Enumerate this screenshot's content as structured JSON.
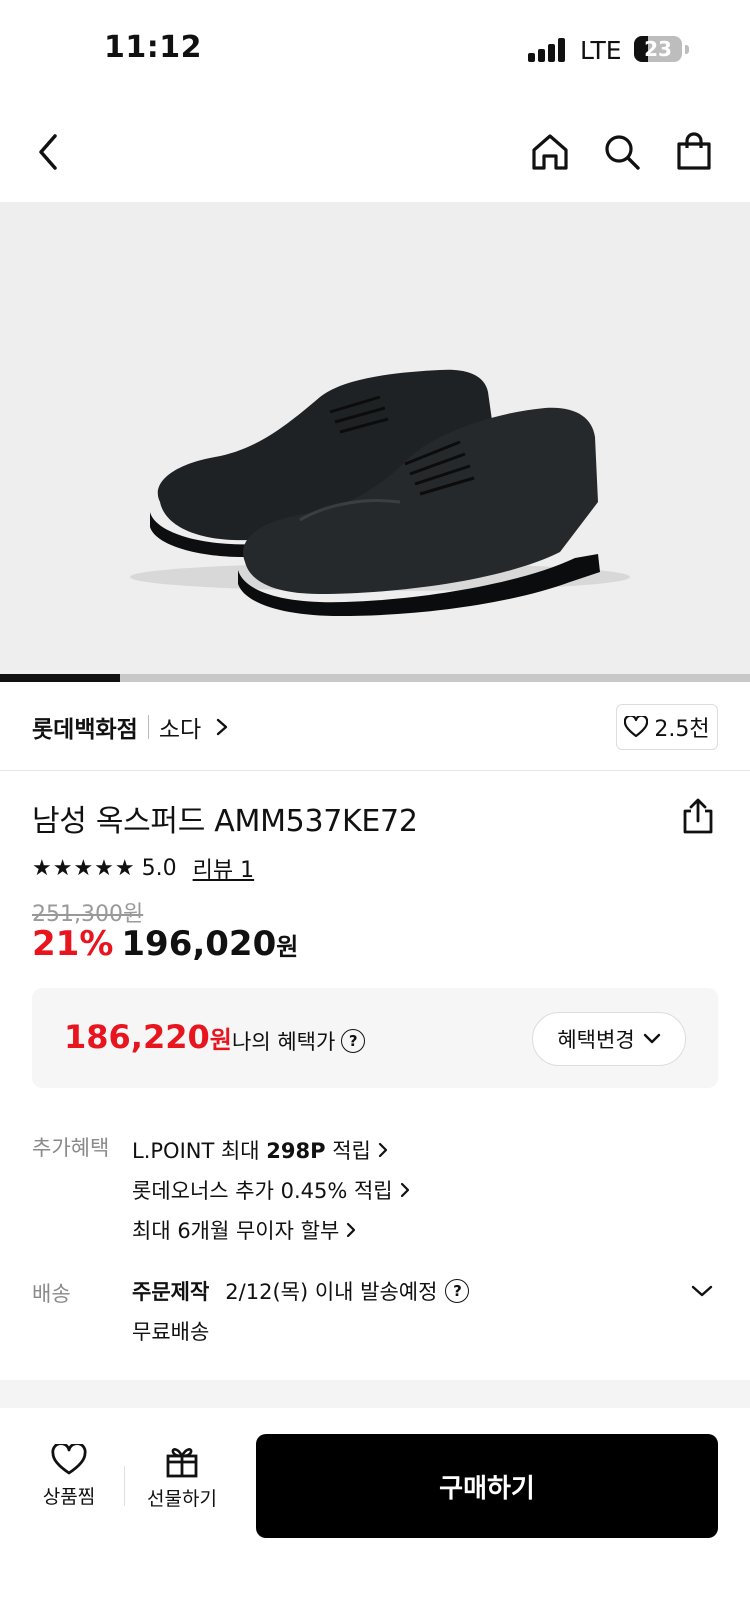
{
  "status_bar": {
    "time": "11:12",
    "network": "LTE",
    "battery": "23"
  },
  "nav": {
    "icons": [
      "back-icon",
      "home-icon",
      "search-icon",
      "shopping-bag-icon"
    ]
  },
  "gallery": {
    "image_alt": "men's black leather oxford shoes",
    "progress_fraction": 0.16
  },
  "brand": {
    "store": "롯데백화점",
    "name": "소다",
    "like_count": "2.5천"
  },
  "product": {
    "title": "남성 옥스퍼드 AMM537KE72",
    "rating": "5.0",
    "review_link": "리뷰 1",
    "original_price": "251,300원",
    "discount": "21%",
    "price": "196,020",
    "price_unit": "원"
  },
  "benefit": {
    "price": "186,220",
    "price_unit": "원",
    "label": "나의 혜택가",
    "change_button": "혜택변경"
  },
  "extra": {
    "label": "추가혜택",
    "items": [
      {
        "prefix": "L.POINT 최대 ",
        "bold": "298P",
        "suffix": " 적립"
      },
      {
        "prefix": "롯데오너스 추가 0.45% 적립",
        "bold": "",
        "suffix": ""
      },
      {
        "prefix": "최대 6개월 무이자 할부",
        "bold": "",
        "suffix": ""
      }
    ]
  },
  "shipping": {
    "label": "배송",
    "type": "주문제작",
    "date": "2/12(목) 이내 발송예정",
    "fee": "무료배송"
  },
  "bottom_bar": {
    "wish_label": "상품찜",
    "gift_label": "선물하기",
    "buy_label": "구매하기"
  },
  "colors": {
    "accent_red": "#e8141e",
    "buy_button": "#000000"
  }
}
